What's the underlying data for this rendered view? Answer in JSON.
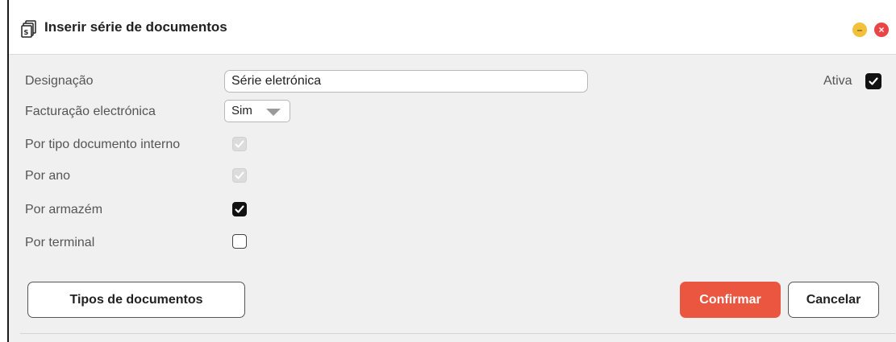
{
  "dialog": {
    "title": "Inserir série de documentos",
    "icon": "documents-series-icon",
    "window_controls": {
      "minimize": "–",
      "close": "×"
    }
  },
  "form": {
    "designacao_label": "Designação",
    "designacao_value": "Série eletrónica",
    "ativa_label": "Ativa",
    "ativa_checked": true,
    "faturacao_label": "Facturação electrónica",
    "faturacao_value": "Sim",
    "por_tipo_label": "Por tipo documento interno",
    "por_tipo_checked": true,
    "por_tipo_disabled": true,
    "por_ano_label": "Por ano",
    "por_ano_checked": true,
    "por_ano_disabled": true,
    "por_armazem_label": "Por armazém",
    "por_armazem_checked": true,
    "por_terminal_label": "Por terminal",
    "por_terminal_checked": false
  },
  "buttons": {
    "tipos": "Tipos de documentos",
    "confirmar": "Confirmar",
    "cancelar": "Cancelar"
  },
  "colors": {
    "primary": "#ea5640",
    "minimize": "#f2c13b",
    "close": "#e84545"
  }
}
